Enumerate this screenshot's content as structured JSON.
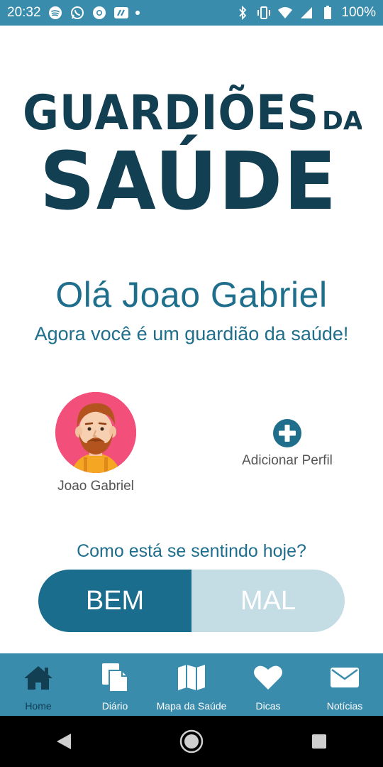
{
  "status_bar": {
    "time": "20:32",
    "battery": "100%"
  },
  "logo": {
    "line1": "GUARDIÕES",
    "line1_suffix": "DA",
    "line2": "SAÚDE"
  },
  "greeting": "Olá Joao Gabriel",
  "subtitle": "Agora você é um guardião da saúde!",
  "profiles": [
    {
      "name": "Joao Gabriel",
      "avatar": "bearded-man-avatar"
    }
  ],
  "add_profile": {
    "label": "Adicionar Perfil",
    "icon": "plus-circle-icon"
  },
  "mood": {
    "question": "Como está se sentindo hoje?",
    "good_label": "BEM",
    "bad_label": "MAL"
  },
  "bottom_nav": [
    {
      "label": "Home",
      "icon": "home-icon",
      "active": true
    },
    {
      "label": "Diário",
      "icon": "document-icon",
      "active": false
    },
    {
      "label": "Mapa da Saúde",
      "icon": "map-icon",
      "active": false
    },
    {
      "label": "Dicas",
      "icon": "heart-icon",
      "active": false
    },
    {
      "label": "Notícias",
      "icon": "envelope-icon",
      "active": false
    }
  ],
  "colors": {
    "primary": "#1f6e8c",
    "logo": "#123f52",
    "nav_bg": "#3a8cad",
    "toggle_active": "#1a6d8c",
    "toggle_inactive": "#c4dce4",
    "avatar_bg": "#f24f7a"
  }
}
